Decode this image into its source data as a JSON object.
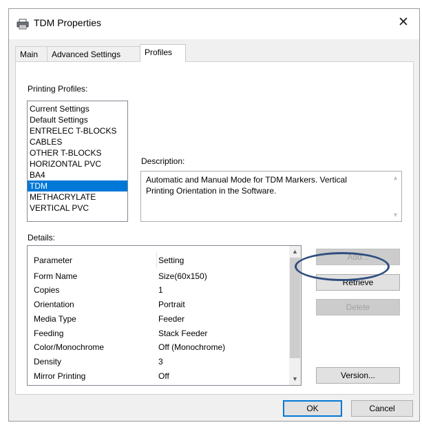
{
  "window": {
    "title": "TDM Properties",
    "close_glyph": "✕"
  },
  "tabs": [
    {
      "label": "Main",
      "active": false
    },
    {
      "label": "Advanced Settings",
      "active": false
    },
    {
      "label": "Profiles",
      "active": true
    }
  ],
  "profiles": {
    "label": "Printing Profiles:",
    "items": [
      "Current Settings",
      "Default Settings",
      "ENTRELEC T-BLOCKS",
      "CABLES",
      "OTHER T-BLOCKS",
      "HORIZONTAL PVC",
      "BA4",
      "TDM",
      "METHACRYLATE",
      "VERTICAL PVC"
    ],
    "selected": "TDM"
  },
  "description": {
    "label": "Description:",
    "text": "Automatic and Manual Mode for TDM Markers. Vertical Printing Orientation in the Software."
  },
  "details": {
    "label": "Details:",
    "columns": [
      "Parameter",
      "Setting"
    ],
    "rows": [
      [
        "Form Name",
        "Size(60x150)"
      ],
      [
        "Copies",
        "1"
      ],
      [
        "Orientation",
        "Portrait"
      ],
      [
        "Media Type",
        "Feeder"
      ],
      [
        "Feeding",
        "Stack Feeder"
      ],
      [
        "Color/Monochrome",
        "Off (Monochrome)"
      ],
      [
        "Density",
        "3"
      ],
      [
        "Mirror Printing",
        "Off"
      ]
    ]
  },
  "buttons": {
    "add": "Add...",
    "retrieve": "Retrieve",
    "delete": "Delete",
    "version": "Version...",
    "ok": "OK",
    "cancel": "Cancel"
  },
  "icons": {
    "title": "printer-icon",
    "scroll_up": "chevron-up-icon",
    "scroll_down": "chevron-down-icon"
  },
  "colors": {
    "selection": "#0078d7",
    "annotation_oval": "#2f4d7e"
  }
}
